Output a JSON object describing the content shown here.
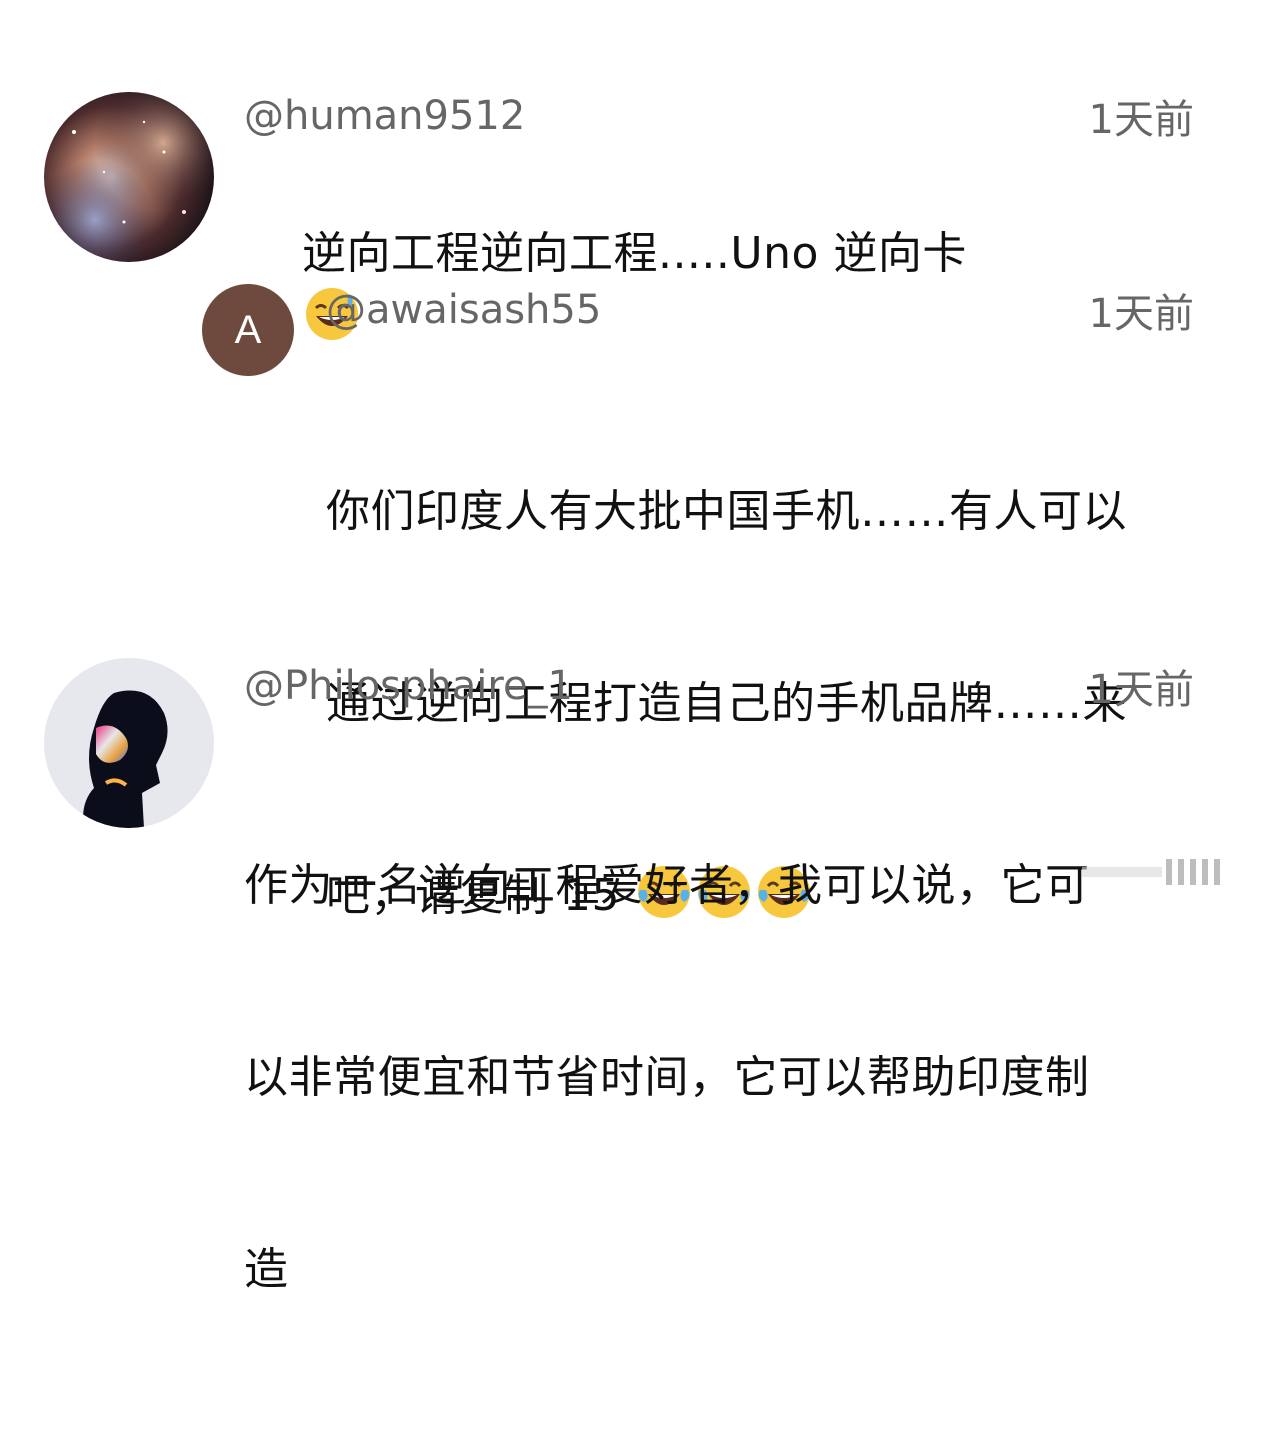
{
  "comments": [
    {
      "username": "@human9512",
      "time": "1天前",
      "text": "逆向工程逆向工程.....Uno 逆向卡",
      "emoji": "sweat-smile-emoji"
    },
    {
      "username": "@awaisash55",
      "time": "1天前",
      "avatar_letter": "A",
      "avatar_color": "#6e4a3e",
      "line1": "你们印度人有大批中国手机……有人可以",
      "line2": "通过逆向工程打造自己的手机品牌……来",
      "line3": "吧，请复制 15",
      "emoji": "tears-of-joy-emoji"
    },
    {
      "username": "@Philosphaire_1",
      "time": "1天前",
      "line1": "作为一名逆向工程爱好者，我可以说，它可",
      "line2": "以非常便宜和节省时间，它可以帮助印度制",
      "line3": "造"
    }
  ]
}
